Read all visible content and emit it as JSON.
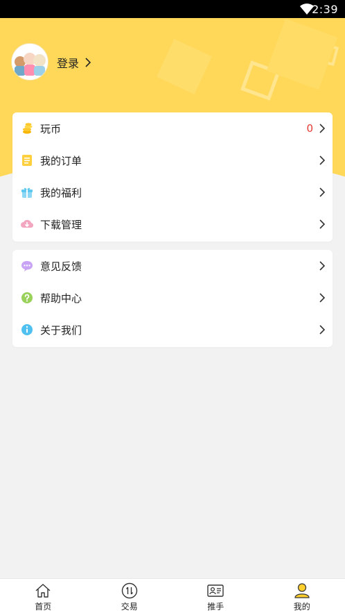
{
  "status_bar": {
    "time": "2:39"
  },
  "profile": {
    "login_label": "登录"
  },
  "menu_group_1": [
    {
      "label": "玩币",
      "value": "0",
      "icon": "coins-icon"
    },
    {
      "label": "我的订单",
      "icon": "order-icon"
    },
    {
      "label": "我的福利",
      "icon": "gift-icon"
    },
    {
      "label": "下载管理",
      "icon": "download-icon"
    }
  ],
  "menu_group_2": [
    {
      "label": "意见反馈",
      "icon": "feedback-icon"
    },
    {
      "label": "帮助中心",
      "icon": "help-icon"
    },
    {
      "label": "关于我们",
      "icon": "info-icon"
    }
  ],
  "tabbar": [
    {
      "label": "首页",
      "icon": "home-icon"
    },
    {
      "label": "交易",
      "icon": "exchange-icon"
    },
    {
      "label": "推手",
      "icon": "promoter-card-icon"
    },
    {
      "label": "我的",
      "icon": "user-icon",
      "active": true
    }
  ],
  "colors": {
    "header_yellow": "#ffd85a",
    "accent_red": "#e53935",
    "page_bg": "#f2f2f2"
  }
}
